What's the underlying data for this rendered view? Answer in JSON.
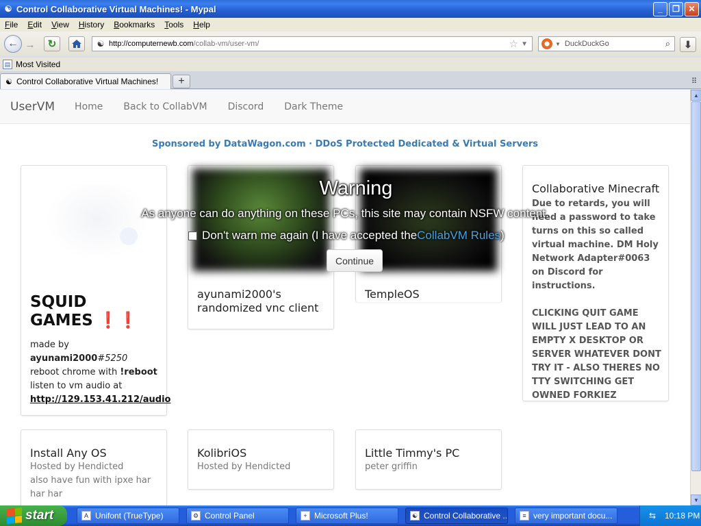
{
  "window": {
    "title": "Control Collaborative Virtual Machines! - Mypal",
    "minimize": "_",
    "maximize": "❐",
    "close": "✕"
  },
  "menu": [
    "File",
    "Edit",
    "View",
    "History",
    "Bookmarks",
    "Tools",
    "Help"
  ],
  "navigation": {
    "url_host": "http://computernewb.com",
    "url_path": "/collab-vm/user-vm/",
    "search_placeholder": "DuckDuckGo"
  },
  "bookmarks": {
    "most_visited": "Most Visited"
  },
  "tabs": {
    "active_label": "Control Collaborative Virtual Machines!",
    "new_tab": "+"
  },
  "site": {
    "brand": "UserVM",
    "nav": [
      "Home",
      "Back to CollabVM",
      "Discord",
      "Dark Theme"
    ],
    "sponsor": "Sponsored by DataWagon.com · DDoS Protected Dedicated & Virtual Servers"
  },
  "cards": {
    "squid": {
      "title_line1": "SQUID",
      "title_line2": "GAMES",
      "title_bangs": "❗❗",
      "made_by": "made by",
      "author": "ayunami2000",
      "author_tag": "#5250",
      "reboot_prefix": "reboot chrome with ",
      "reboot_cmd": "!reboot",
      "audio_text": "listen to vm audio at",
      "audio_link": "http://129.153.41.212/audio"
    },
    "ayunami": {
      "title": "ayunami2000's randomized vnc client"
    },
    "temple": {
      "title": "TempleOS"
    },
    "minecraft": {
      "title": "Collaborative Minecraft",
      "body1": "Due to retards, you will need a password to take turns on this so called virtual machine. DM Holy Network Adapter#0063 on Discord for instructions.",
      "body2": "CLICKING QUIT GAME WILL JUST LEAD TO AN EMPTY X DESKTOP OR SERVER WHATEVER DONT TRY IT - ALSO THERES NO TTY SWITCHING GET OWNED FORKIEZ"
    },
    "install": {
      "title": "Install Any OS",
      "sub1": "Hosted by Hendicted",
      "sub2": "also have fun with ipxe har har har"
    },
    "kolibri": {
      "title": "KolibriOS",
      "sub": "Hosted by Hendicted"
    },
    "timmy": {
      "title": "Little Timmy's PC",
      "sub": "peter griffin"
    }
  },
  "warning": {
    "title": "Warning",
    "text": "As anyone can do anything on these PCs, this site may contain NSFW content.",
    "checkbox_label": "Don't warn me again (I have accepted the ",
    "rules_link": "CollabVM Rules",
    "checkbox_close": ")",
    "checked": false,
    "continue": "Continue"
  },
  "taskbar": {
    "start": "start",
    "tasks": [
      "Unifont (TrueType)",
      "Control Panel",
      "Microsoft Plus!",
      "Control Collaborative ...",
      "very important docu..."
    ],
    "active_task": 3,
    "clock": "10:18 PM"
  }
}
